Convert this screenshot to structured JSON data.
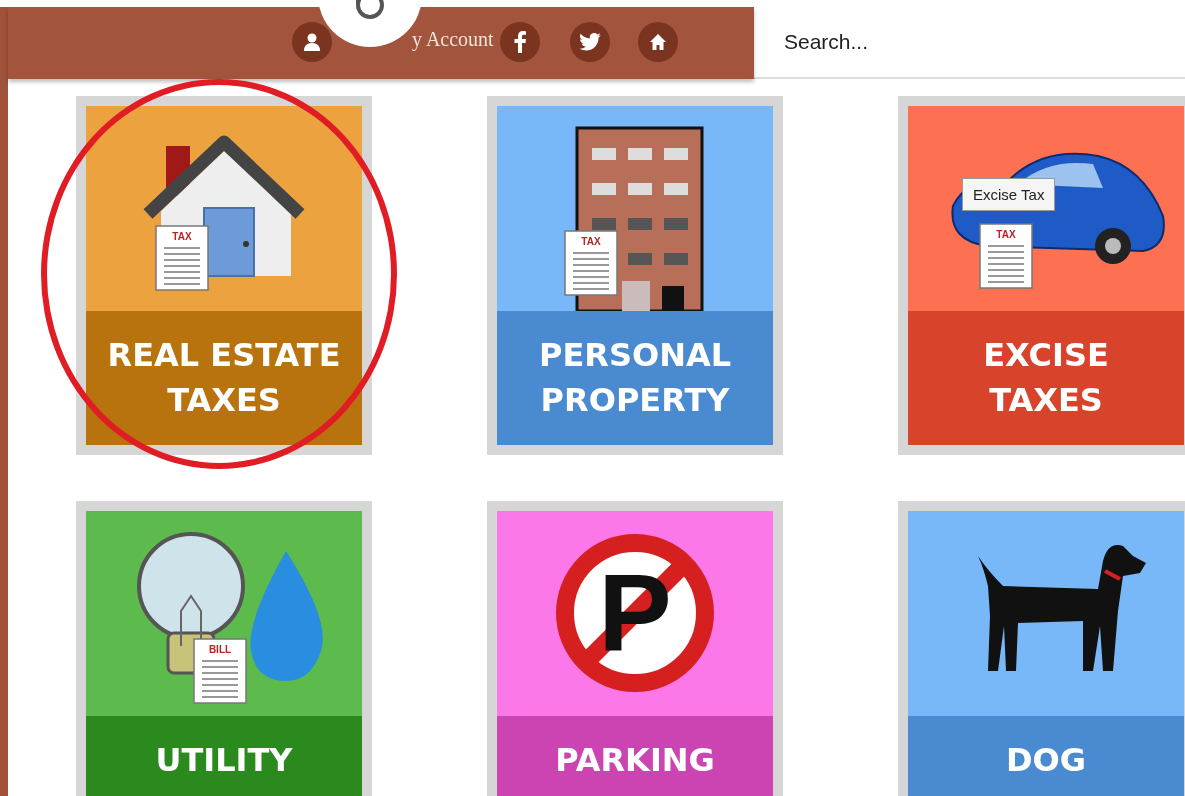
{
  "header": {
    "account_label": "y Account",
    "search": {
      "placeholder": "Search..."
    }
  },
  "tiles": [
    {
      "kind": "house",
      "label_lines": [
        "REAL ESTATE",
        "TAXES"
      ],
      "document_label": "TAX",
      "highlighted": true
    },
    {
      "kind": "building",
      "label_lines": [
        "PERSONAL",
        "PROPERTY"
      ],
      "document_label": "TAX",
      "highlighted": false
    },
    {
      "kind": "car",
      "label_lines": [
        "EXCISE",
        "TAXES"
      ],
      "document_label": "TAX",
      "highlighted": false,
      "tooltip": "Excise Tax"
    },
    {
      "kind": "utility",
      "label_lines": [
        "UTILITY"
      ],
      "document_label": "BILL",
      "highlighted": false
    },
    {
      "kind": "no-parking",
      "label_lines": [
        "PARKING"
      ],
      "sign_letter": "P",
      "highlighted": false
    },
    {
      "kind": "dog",
      "label_lines": [
        "DOG"
      ],
      "highlighted": false
    }
  ]
}
